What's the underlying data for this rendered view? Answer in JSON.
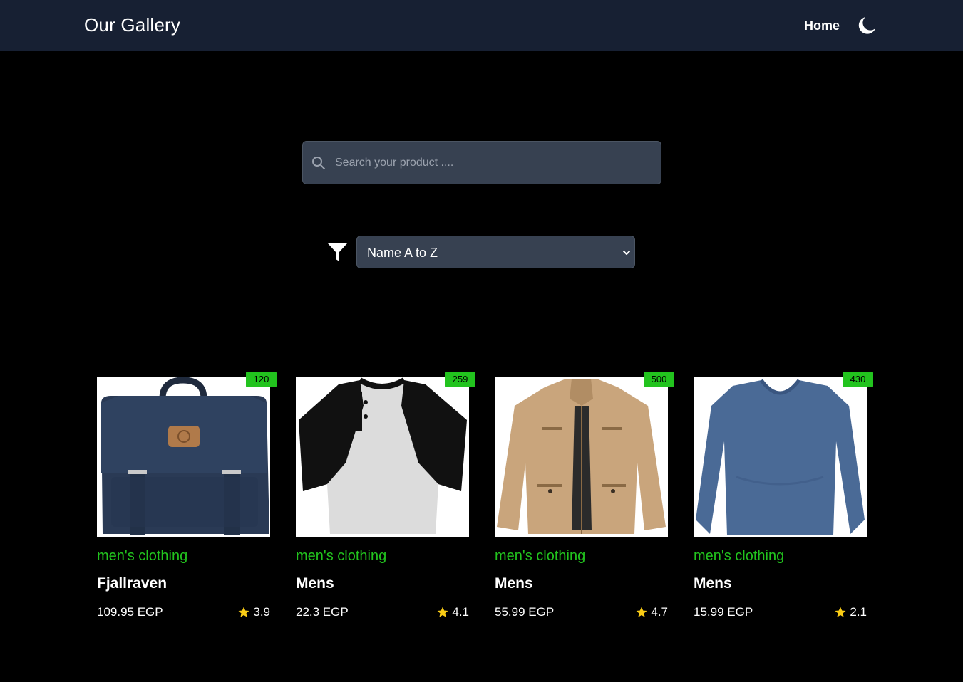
{
  "navbar": {
    "brand": "Our Gallery",
    "home_label": "Home",
    "theme_toggle_icon": "moon-icon"
  },
  "search": {
    "placeholder": "Search your product ....",
    "value": "",
    "icon": "search-icon"
  },
  "filter": {
    "icon": "filter-icon",
    "selected": "Name A to Z"
  },
  "colors": {
    "navbar_bg": "#172033",
    "page_bg": "#000000",
    "accent_green": "#22c31e",
    "input_bg": "#374151",
    "star": "#facc15"
  },
  "products": [
    {
      "badge": "120",
      "category": "men's clothing",
      "title": "Fjallraven",
      "price": "109.95 EGP",
      "rating": "3.9"
    },
    {
      "badge": "259",
      "category": "men's clothing",
      "title": "Mens",
      "price": "22.3 EGP",
      "rating": "4.1"
    },
    {
      "badge": "500",
      "category": "men's clothing",
      "title": "Mens",
      "price": "55.99 EGP",
      "rating": "4.7"
    },
    {
      "badge": "430",
      "category": "men's clothing",
      "title": "Mens",
      "price": "15.99 EGP",
      "rating": "2.1"
    }
  ]
}
